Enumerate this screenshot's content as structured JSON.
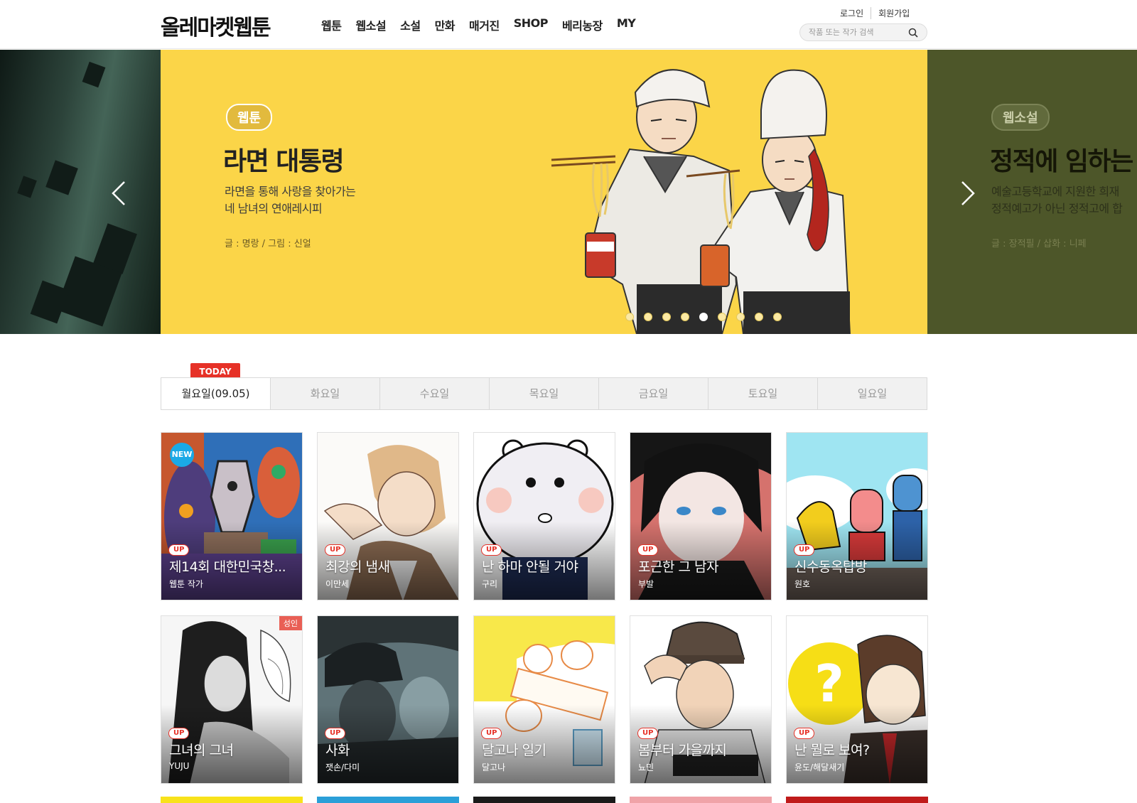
{
  "header": {
    "logo": "올레마켓웹툰",
    "nav": [
      "웹툰",
      "웹소설",
      "소설",
      "만화",
      "매거진",
      "SHOP",
      "베리농장",
      "MY"
    ],
    "login": "로그인",
    "signup": "회원가입",
    "search_placeholder": "작품 또는 작가 검색"
  },
  "banner": {
    "current": {
      "badge": "웹툰",
      "title": "라면 대통령",
      "desc_line1": "라면을 통해 사랑을 찾아가는",
      "desc_line2": "네 남녀의 연애레시피",
      "credit": "글 : 명랑 / 그림 : 신얼"
    },
    "next": {
      "badge": "웹소설",
      "title": "정적에 임하는",
      "desc_line1": "예술고등학교에 지원한 희재",
      "desc_line2": "정적예고가 아닌 정적고에 합",
      "credit": "글 : 장적필 / 삽화 : 니페"
    },
    "slide_count": 9,
    "active_index": 4
  },
  "today_label": "TODAY",
  "days": [
    "월요일(09.05)",
    "화요일",
    "수요일",
    "목요일",
    "금요일",
    "토요일",
    "일요일"
  ],
  "cards": [
    {
      "title": "제14회 대한민국창...",
      "author": "웹툰 작가",
      "badge": "UP",
      "flag": "NEW"
    },
    {
      "title": "최강의 냄새",
      "author": "이만세",
      "badge": "UP"
    },
    {
      "title": "난 하마 안될 거야",
      "author": "구리",
      "badge": "UP"
    },
    {
      "title": "포근한 그 남자",
      "author": "부발",
      "badge": "UP"
    },
    {
      "title": "신수동옥탑방",
      "author": "원호",
      "badge": "UP"
    },
    {
      "title": "그녀의 그녀",
      "author": "YUJU",
      "badge": "UP",
      "flag": "성인"
    },
    {
      "title": "사화",
      "author": "잿손/다미",
      "badge": "UP"
    },
    {
      "title": "달고나 일기",
      "author": "달고나",
      "badge": "UP"
    },
    {
      "title": "봄부터 가을까지",
      "author": "뇨민",
      "badge": "UP"
    },
    {
      "title": "난 뭘로 보여?",
      "author": "윤도/해달새기",
      "badge": "UP"
    }
  ],
  "colors": {
    "banner_yellow": "#fbd548",
    "banner_olive": "#4d5629",
    "accent_red": "#e63127",
    "new_blue": "#1aa9e6"
  }
}
